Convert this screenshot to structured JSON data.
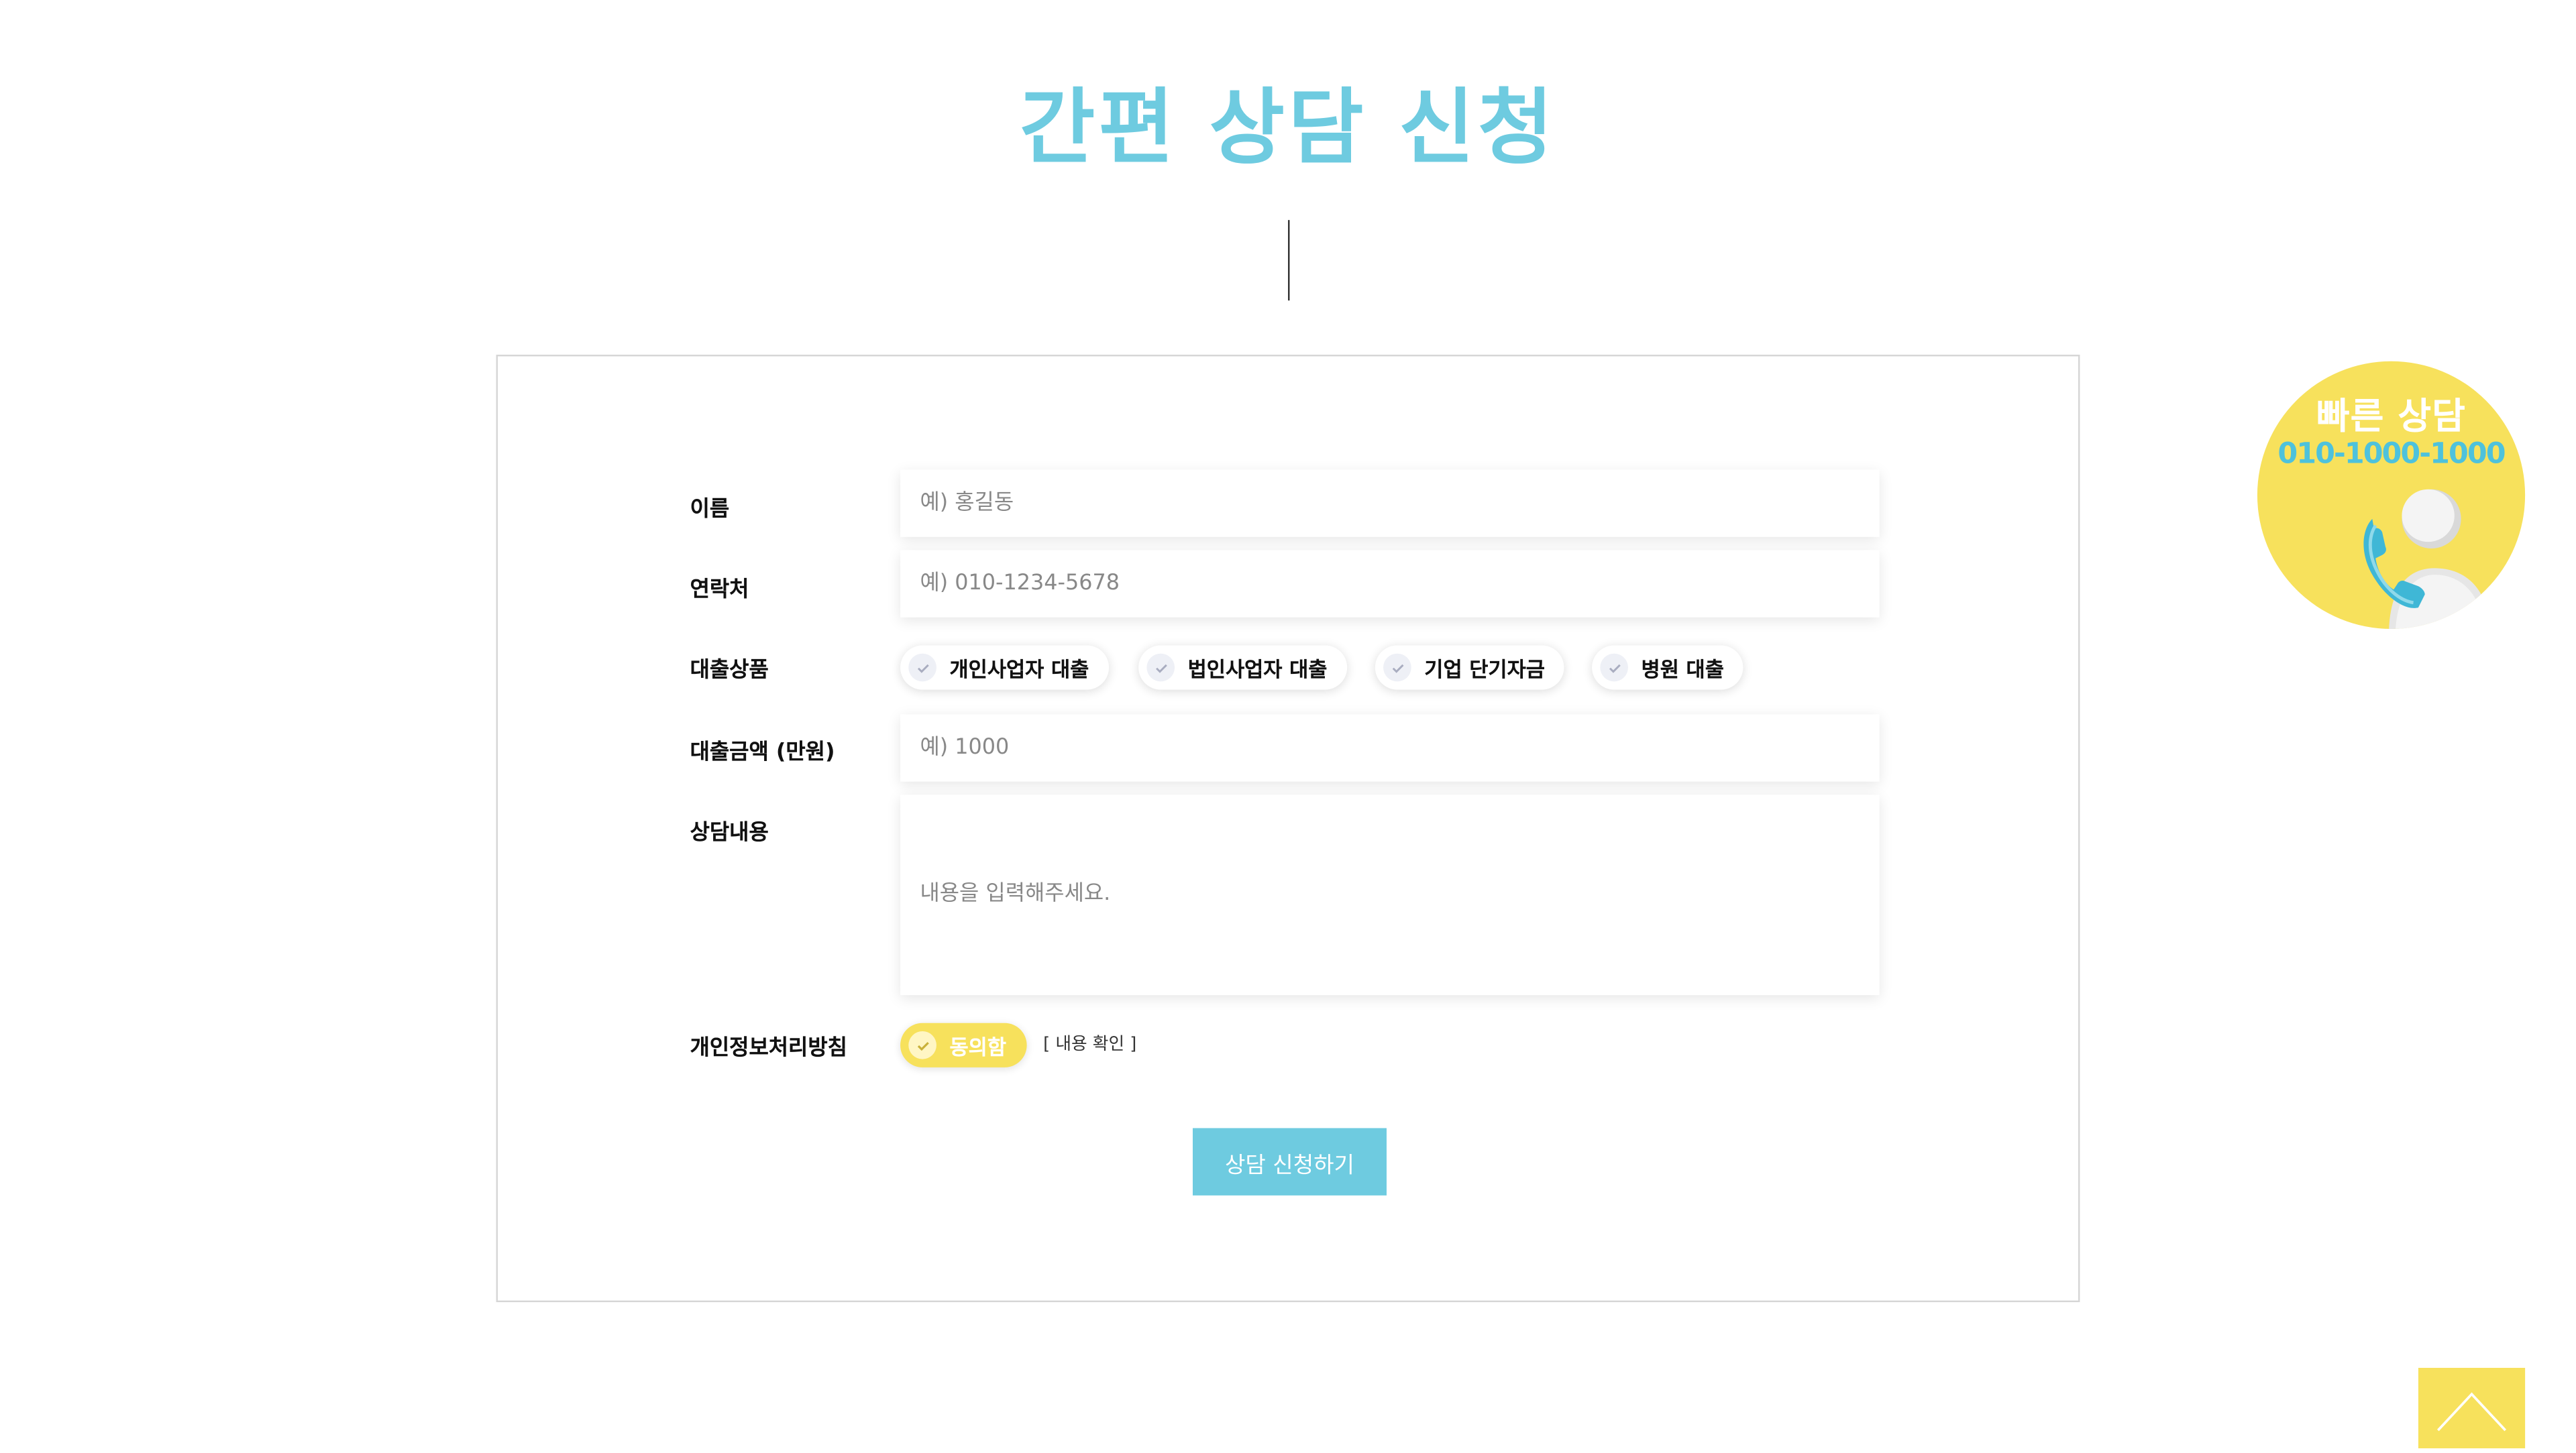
{
  "page": {
    "title": "간편 상담 신청"
  },
  "form": {
    "name": {
      "label": "이름",
      "placeholder": "예) 홍길동"
    },
    "phone": {
      "label": "연락처",
      "placeholder": "예) 010-1234-5678"
    },
    "product": {
      "label": "대출상품",
      "options": [
        "개인사업자 대출",
        "법인사업자 대출",
        "기업 단기자금",
        "병원 대출"
      ]
    },
    "amount": {
      "label": "대출금액 (만원)",
      "placeholder": "예) 1000"
    },
    "content": {
      "label": "상담내용",
      "placeholder": "내용을 입력해주세요."
    },
    "privacy": {
      "label": "개인정보처리방침",
      "agree_label": "동의함",
      "agree_checked": true,
      "view_link": "[ 내용 확인 ]"
    },
    "submit_label": "상담 신청하기"
  },
  "quick_call": {
    "title": "빠른 상담",
    "phone": "010-1000-1000",
    "icon": "phone-person-icon"
  },
  "scroll_top": {
    "icon": "chevron-up-icon"
  },
  "colors": {
    "accent": "#6ecbe0",
    "highlight": "#f7e15c",
    "border": "#d6d6d6",
    "text": "#111111"
  }
}
